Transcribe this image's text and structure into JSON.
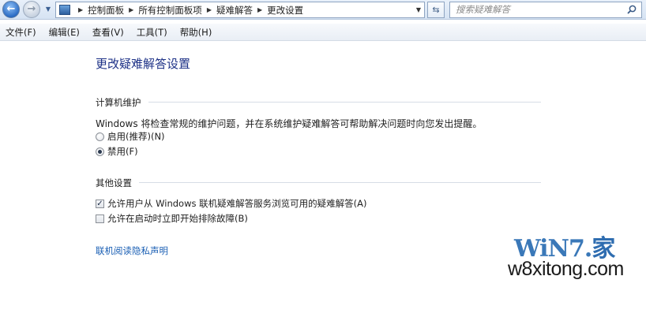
{
  "addressbar": {
    "breadcrumbs": [
      "控制面板",
      "所有控制面板项",
      "疑难解答",
      "更改设置"
    ],
    "search_placeholder": "搜索疑难解答"
  },
  "menu": [
    "文件(F)",
    "编辑(E)",
    "查看(V)",
    "工具(T)",
    "帮助(H)"
  ],
  "page": {
    "title": "更改疑难解答设置",
    "maintenance": {
      "heading": "计算机维护",
      "description": "Windows 将检查常规的维护问题，并在系统维护疑难解答可帮助解决问题时向您发出提醒。",
      "options": [
        {
          "label": "启用(推荐)(N)",
          "selected": false
        },
        {
          "label": "禁用(F)",
          "selected": true
        }
      ]
    },
    "other": {
      "heading": "其他设置",
      "options": [
        {
          "label": "允许用户从 Windows 联机疑难解答服务浏览可用的疑难解答(A)",
          "checked": true
        },
        {
          "label": "允许在启动时立即开始排除故障(B)",
          "checked": false
        }
      ]
    },
    "privacy_link": "联机阅读隐私声明"
  },
  "watermark": {
    "logo": "WiN7.",
    "logo_suffix": "家",
    "url": "w8xitong.com"
  },
  "colors": {
    "title": "#1e3287",
    "link": "#1a5fb4",
    "watermark_logo": "#3a78b8"
  },
  "icons": {
    "back": "back-arrow-icon",
    "forward": "forward-arrow-icon",
    "refresh": "refresh-icon",
    "search": "search-icon",
    "control_panel": "control-panel-icon"
  }
}
